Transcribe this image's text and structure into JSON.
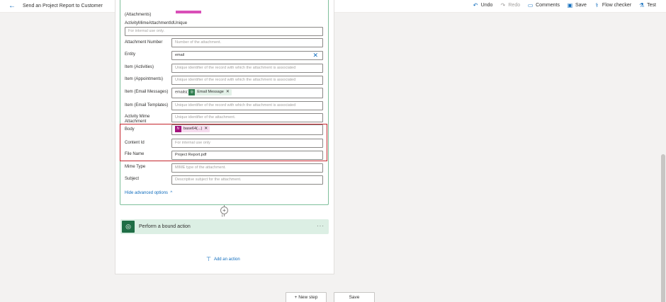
{
  "header": {
    "title": "Send an Project Report to Customer",
    "actions": [
      {
        "label": "Undo",
        "icon": "undo-icon",
        "glyph": "↶",
        "disabled": false
      },
      {
        "label": "Redo",
        "icon": "redo-icon",
        "glyph": "↷",
        "disabled": true
      },
      {
        "label": "Comments",
        "icon": "comment-icon",
        "glyph": "▭",
        "disabled": false
      },
      {
        "label": "Save",
        "icon": "save-icon",
        "glyph": "▣",
        "disabled": false
      },
      {
        "label": "Flow checker",
        "icon": "stethoscope-icon",
        "glyph": "⚕",
        "disabled": false
      },
      {
        "label": "Test",
        "icon": "flask-icon",
        "glyph": "⚗",
        "disabled": false
      }
    ]
  },
  "form": {
    "attachments_label": "(Attachments)",
    "mime_unique_label": "ActivityMimeAttachmentIdUnique",
    "mime_unique_placeholder": "For internal use only.",
    "fields": [
      {
        "label": "Attachment Number",
        "placeholder": "Number of the attachment."
      },
      {
        "label": "Entity",
        "value": "email"
      },
      {
        "label": "Item (Activities)",
        "placeholder": "Unique identifier of the record with which the attachment is associated"
      },
      {
        "label": "Item (Appointments)",
        "placeholder": "Unique identifier of the record with which the attachment is associated"
      },
      {
        "label": "Item (Email Messages)",
        "prefix": "emails(",
        "token": "Email Message"
      },
      {
        "label": "Item (Email Templates)",
        "placeholder": "Unique identifier of the record with which the attachment is associated"
      },
      {
        "label": "Activity Mime Attachment",
        "placeholder": "Unique identifier of the attachment."
      },
      {
        "label": "Body",
        "token": "base64(...)"
      },
      {
        "label": "Content Id",
        "placeholder": "For internal use only"
      },
      {
        "label": "File Name",
        "value": "Project Report.pdf"
      },
      {
        "label": "Mime Type",
        "placeholder": "MIME type of the attachment."
      },
      {
        "label": "Subject",
        "placeholder": "Descriptive subject for the attachment."
      }
    ],
    "hide_advanced": "Hide advanced options",
    "token_fx": "fx"
  },
  "flow": {
    "bound_action_label": "Perform a bound action",
    "more": "···",
    "add_action": "Add an action"
  },
  "bottom": {
    "new_step": "+ New step",
    "save": "Save"
  },
  "colors": {
    "accent": "#0f6cbd",
    "highlight": "#c4262e",
    "dataverse_green": "#1f6d45",
    "expression_pink": "#a4127d"
  }
}
